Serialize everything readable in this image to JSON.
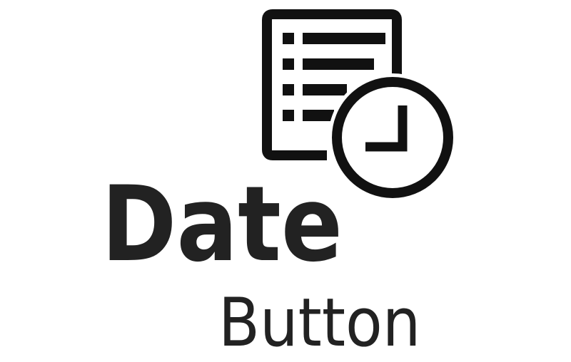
{
  "icon": {
    "name": "document-clock-icon",
    "stroke_color": "#111111"
  },
  "label": {
    "primary": "Date",
    "secondary": "Button"
  },
  "colors": {
    "background": "#ffffff",
    "text": "#222222"
  }
}
